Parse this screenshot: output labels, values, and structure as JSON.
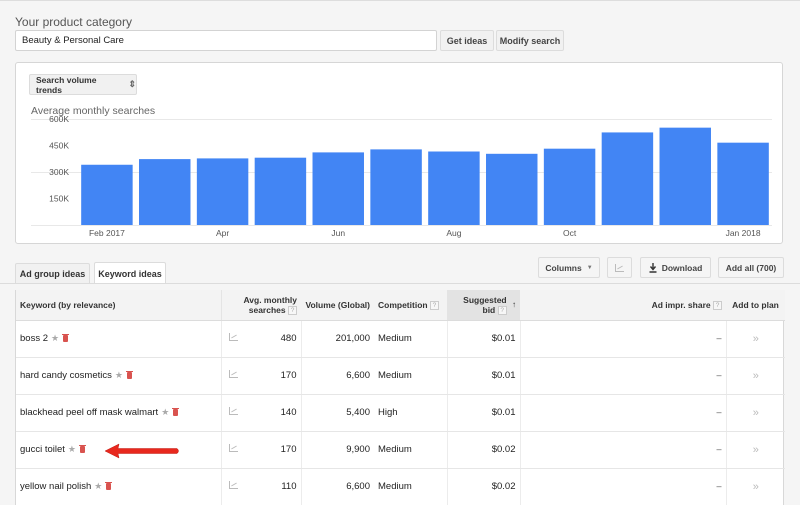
{
  "category": {
    "label": "Your product category",
    "value": "Beauty & Personal Care",
    "get_ideas_label": "Get ideas",
    "modify_search_label": "Modify search"
  },
  "chart_panel": {
    "selector_label": "Search volume trends",
    "selector_icon": "updown-arrows-icon"
  },
  "chart_data": {
    "type": "bar",
    "title": "Average monthly searches",
    "xlabel": "",
    "ylabel": "",
    "categories": [
      "Feb 2017",
      "Mar 2017",
      "Apr 2017",
      "May 2017",
      "Jun 2017",
      "Jul 2017",
      "Aug 2017",
      "Sep 2017",
      "Oct 2017",
      "Nov 2017",
      "Dec 2017",
      "Jan 2018"
    ],
    "x_tick_labels": [
      {
        "index": 0,
        "label": "Feb 2017"
      },
      {
        "index": 2,
        "label": "Apr"
      },
      {
        "index": 4,
        "label": "Jun"
      },
      {
        "index": 6,
        "label": "Aug"
      },
      {
        "index": 8,
        "label": "Oct"
      },
      {
        "index": 11,
        "label": "Jan 2018"
      }
    ],
    "values": [
      341000,
      373000,
      377000,
      381000,
      411000,
      428000,
      416000,
      403000,
      432000,
      524000,
      551000,
      466000
    ],
    "ylim": [
      0,
      600000
    ],
    "y_ticks": [
      {
        "value": 150000,
        "label": "150K"
      },
      {
        "value": 300000,
        "label": "300K"
      },
      {
        "value": 450000,
        "label": "450K"
      },
      {
        "value": 600000,
        "label": "600K"
      }
    ],
    "gridlines": [
      0,
      300000,
      600000
    ],
    "bar_color": "#4285f4",
    "grid": true,
    "legend": "none"
  },
  "tabs": [
    {
      "label": "Ad group ideas",
      "active": false
    },
    {
      "label": "Keyword ideas",
      "active": true
    }
  ],
  "toolbar": {
    "columns_label": "Columns",
    "graph_icon": "line-chart-icon",
    "download_label": "Download",
    "add_all_label": "Add all (700)"
  },
  "table": {
    "headers": {
      "keyword": "Keyword (by relevance)",
      "avg_monthly_line1": "Avg. monthly",
      "avg_monthly_line2": "searches",
      "volume": "Volume (Global)",
      "competition": "Competition",
      "bid_line1": "Suggested",
      "bid_line2": "bid",
      "impr_share": "Ad impr. share",
      "add_to_plan": "Add to plan",
      "help": "?",
      "sort_indicator": "↑"
    },
    "rows": [
      {
        "keyword": "boss 2",
        "avg": "480",
        "volume": "201,000",
        "competition": "Medium",
        "bid": "$0.01",
        "impr": "–",
        "add": "»"
      },
      {
        "keyword": "hard candy cosmetics",
        "avg": "170",
        "volume": "6,600",
        "competition": "Medium",
        "bid": "$0.01",
        "impr": "–",
        "add": "»"
      },
      {
        "keyword": "blackhead peel off mask walmart",
        "avg": "140",
        "volume": "5,400",
        "competition": "High",
        "bid": "$0.01",
        "impr": "–",
        "add": "»"
      },
      {
        "keyword": "gucci toilet",
        "avg": "170",
        "volume": "9,900",
        "competition": "Medium",
        "bid": "$0.02",
        "impr": "–",
        "add": "»"
      },
      {
        "keyword": "yellow nail polish",
        "avg": "110",
        "volume": "6,600",
        "competition": "Medium",
        "bid": "$0.02",
        "impr": "–",
        "add": "»"
      }
    ]
  },
  "annotation": {
    "arrow_color": "#e8281e",
    "points_to_row": 3
  },
  "glyphs": {
    "star": "★",
    "updown": "⇕",
    "caret": "▼",
    "download": "⭳"
  }
}
